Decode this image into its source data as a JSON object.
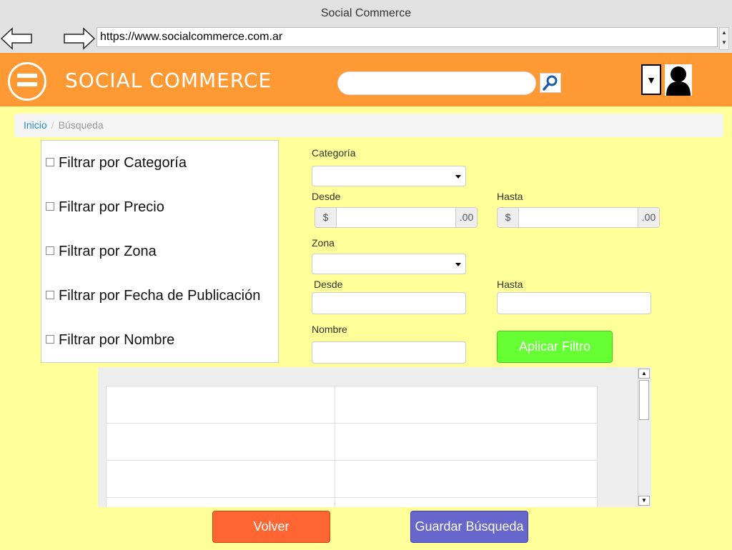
{
  "window": {
    "title": "Social Commerce"
  },
  "browser": {
    "url": "https://www.socialcommerce.com.ar"
  },
  "header": {
    "brand": "SOCIAL COMMERCE",
    "search_placeholder": "",
    "dropdown_glyph": "▼",
    "colors": {
      "bar": "#ff9933"
    }
  },
  "breadcrumb": {
    "home": "Inicio",
    "separator": "/",
    "current": "Búsqueda"
  },
  "filters": [
    {
      "label": "Filtrar por Categoría",
      "checked": false
    },
    {
      "label": "Filtrar por Precio",
      "checked": false
    },
    {
      "label": "Filtrar por Zona",
      "checked": false
    },
    {
      "label": "Filtrar por Fecha de Publicación",
      "checked": false
    },
    {
      "label": "Filtrar por Nombre",
      "checked": false
    }
  ],
  "form": {
    "categoria_label": "Categoría",
    "categoria_value": "",
    "precio": {
      "desde_label": "Desde",
      "hasta_label": "Hasta",
      "currency_prefix": "$",
      "suffix": ".00",
      "desde_value": "",
      "hasta_value": ""
    },
    "zona_label": "Zona",
    "zona_value": "",
    "fecha": {
      "desde_label": "Desde",
      "hasta_label": "Hasta",
      "desde_value": "",
      "hasta_value": ""
    },
    "nombre_label": "Nombre",
    "nombre_value": "",
    "apply_label": "Aplicar Filtro"
  },
  "results": {
    "rows": [
      [
        "",
        ""
      ],
      [
        "",
        ""
      ],
      [
        "",
        ""
      ],
      [
        "",
        ""
      ]
    ]
  },
  "footer": {
    "back_label": "Volver",
    "save_label": "Guardar Búsqueda",
    "colors": {
      "back": "#ff6633",
      "save": "#6666cc",
      "apply": "#66ff33"
    }
  }
}
